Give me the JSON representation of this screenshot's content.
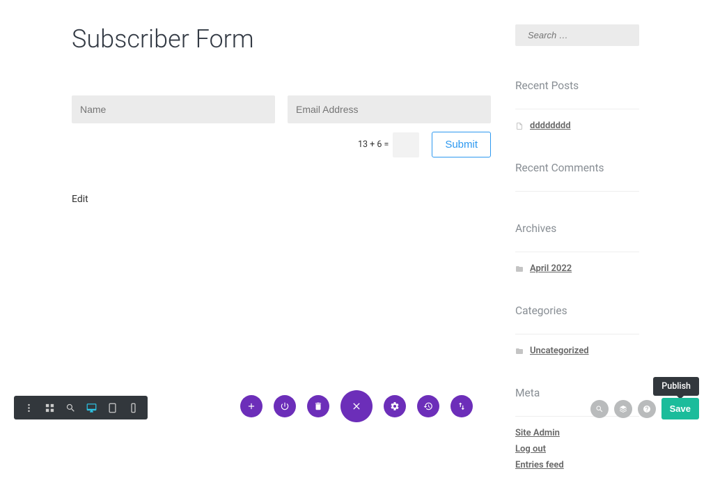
{
  "page": {
    "title": "Subscriber Form",
    "edit_label": "Edit"
  },
  "form": {
    "name_placeholder": "Name",
    "email_placeholder": "Email Address",
    "captcha_question": "13 + 6 =",
    "submit_label": "Submit"
  },
  "sidebar": {
    "search_placeholder": "Search …",
    "recent_posts_title": "Recent Posts",
    "recent_posts": [
      "dddddddd"
    ],
    "recent_comments_title": "Recent Comments",
    "archives_title": "Archives",
    "archives": [
      "April 2022"
    ],
    "categories_title": "Categories",
    "categories": [
      "Uncategorized"
    ],
    "meta_title": "Meta",
    "meta_links": [
      "Site Admin",
      "Log out",
      "Entries feed"
    ]
  },
  "builder": {
    "tooltip": "Publish",
    "save_label": "Save"
  }
}
